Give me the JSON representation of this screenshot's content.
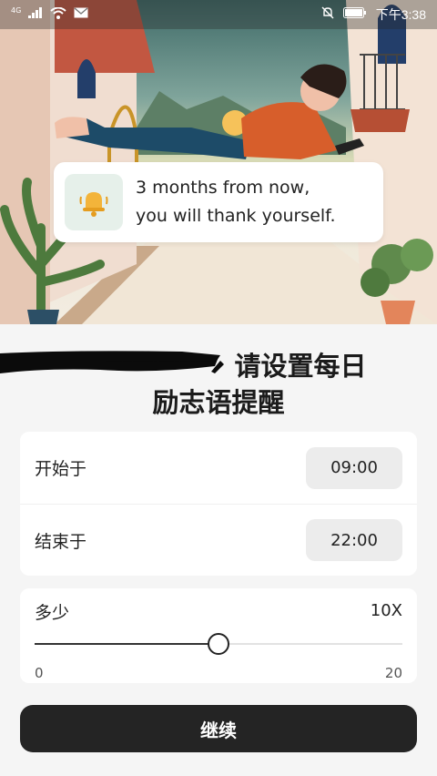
{
  "status_bar": {
    "network": "4G",
    "time": "下午3:38",
    "icons": [
      "signal-icon",
      "wifi-icon",
      "mail-icon",
      "mute-bell-icon",
      "battery-icon"
    ]
  },
  "notification": {
    "icon": "bell-icon",
    "line1": "3 months from now,",
    "line2": "you will thank yourself."
  },
  "headline": {
    "line1": "请设置每日",
    "line2": "励志语提醒"
  },
  "schedule": {
    "start_label": "开始于",
    "start_value": "09:00",
    "end_label": "结束于",
    "end_value": "22:00"
  },
  "frequency": {
    "label": "多少",
    "value_text": "10X",
    "min": "0",
    "max": "20",
    "current": 10
  },
  "continue_label": "继续",
  "colors": {
    "primary_button": "#242424",
    "background": "#f5f5f5",
    "bell_bg": "#e6f0ea",
    "bell": "#f3b43a"
  }
}
